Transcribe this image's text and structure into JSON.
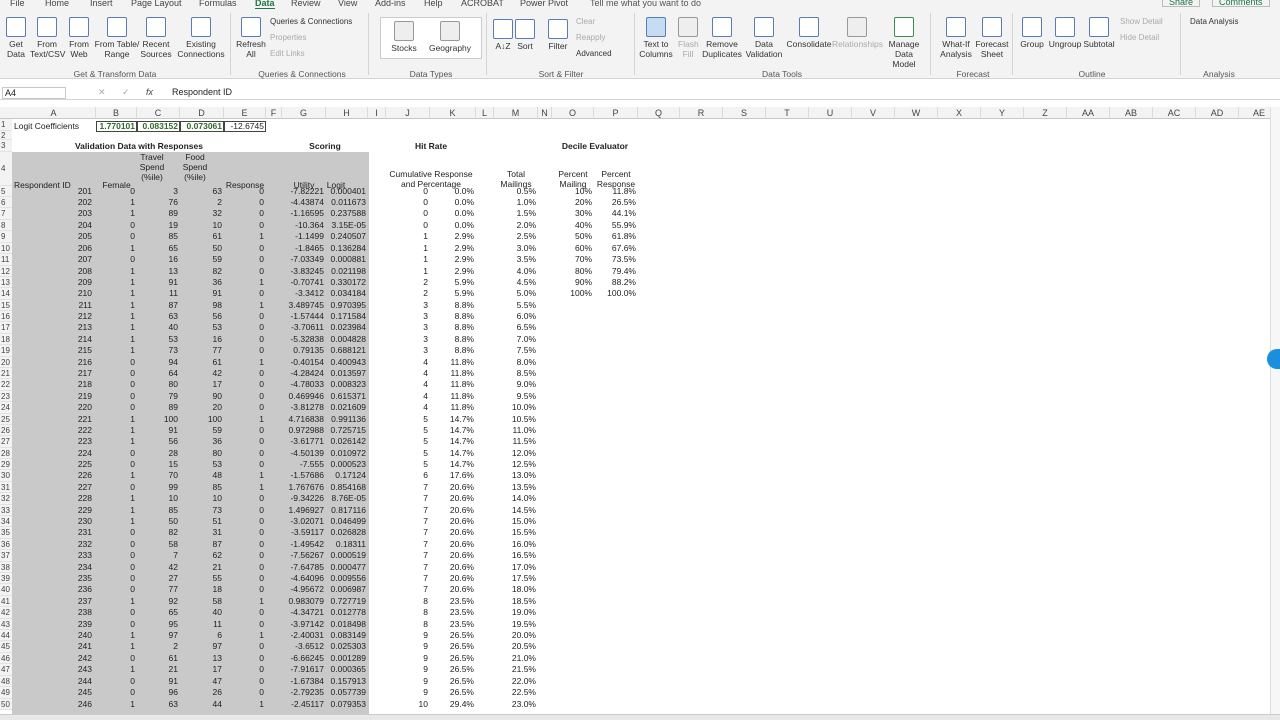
{
  "tabs": [
    "File",
    "Home",
    "Insert",
    "Page Layout",
    "Formulas",
    "Data",
    "Review",
    "View",
    "Add-ins",
    "Help",
    "ACROBAT",
    "Power Pivot"
  ],
  "active_tab": "Data",
  "tell_me": "Tell me what you want to do",
  "share": "Share",
  "comments": "Comments",
  "ribbon": {
    "get_data": "Get Data",
    "from_text": "From Text/CSV",
    "from_web": "From Web",
    "from_table": "From Table/ Range",
    "recent_sources": "Recent Sources",
    "existing_connections": "Existing Connections",
    "refresh_all": "Refresh All",
    "queries_connections": "Queries & Connections",
    "properties": "Properties",
    "edit_links": "Edit Links",
    "stocks": "Stocks",
    "geography": "Geography",
    "sort_az": "A↓Z",
    "sort": "Sort",
    "filter": "Filter",
    "clear": "Clear",
    "reapply": "Reapply",
    "advanced": "Advanced",
    "text_to_columns": "Text to Columns",
    "flash_fill": "Flash Fill",
    "remove_duplicates": "Remove Duplicates",
    "data_validation": "Data Validation",
    "consolidate": "Consolidate",
    "relationships": "Relationships",
    "manage_data_model": "Manage Data Model",
    "what_if": "What-If Analysis",
    "forecast_sheet": "Forecast Sheet",
    "group": "Group",
    "ungroup": "Ungroup",
    "subtotal": "Subtotal",
    "show_detail": "Show Detail",
    "hide_detail": "Hide Detail",
    "data_analysis": "Data Analysis",
    "groups": [
      "Get & Transform Data",
      "Queries & Connections",
      "Data Types",
      "Sort & Filter",
      "Data Tools",
      "Forecast",
      "Outline",
      "Analysis"
    ]
  },
  "formula_bar": {
    "name_box": "A4",
    "cancel": "✕",
    "enter": "✓",
    "fx": "fx",
    "content": "Respondent ID"
  },
  "columns": [
    "A",
    "B",
    "C",
    "D",
    "E",
    "F",
    "G",
    "H",
    "I",
    "J",
    "K",
    "L",
    "M",
    "N",
    "O",
    "P",
    "Q",
    "R",
    "S",
    "T",
    "U",
    "V",
    "W",
    "X",
    "Y",
    "Z",
    "AA",
    "AB",
    "AC",
    "AD",
    "AE"
  ],
  "row1": {
    "label": "Logit Coefficients",
    "c1": "1.770101",
    "c2": "0.083152",
    "c3": "0.073061",
    "c4": "-12.6745"
  },
  "headers": {
    "validation": "Validation Data with Responses",
    "scoring": "Scoring",
    "hit_rate": "Hit Rate",
    "decile": "Decile Evaluator",
    "respondent_id": "Respondent ID",
    "female": "Female",
    "travel_spend": "Travel Spend (%ile)",
    "food_spend": "Food Spend (%ile)",
    "response": "Response",
    "utility": "Utility",
    "logit": "Logit",
    "cumulative": "Cumulative Response and Percentage",
    "total_mailings": "Total Mailings",
    "percent_mailing": "Percent Mailing",
    "percent_response": "Percent Response"
  },
  "rows": [
    [
      "201",
      "0",
      "3",
      "63",
      "0",
      "-7.82221",
      "0.000401",
      "0",
      "0.0%",
      "0.5%"
    ],
    [
      "202",
      "1",
      "76",
      "2",
      "0",
      "-4.43874",
      "0.011673",
      "0",
      "0.0%",
      "1.0%"
    ],
    [
      "203",
      "1",
      "89",
      "32",
      "0",
      "-1.16595",
      "0.237588",
      "0",
      "0.0%",
      "1.5%"
    ],
    [
      "204",
      "0",
      "19",
      "10",
      "0",
      "-10.364",
      "3.15E-05",
      "0",
      "0.0%",
      "2.0%"
    ],
    [
      "205",
      "0",
      "85",
      "61",
      "1",
      "-1.1499",
      "0.240507",
      "1",
      "2.9%",
      "2.5%"
    ],
    [
      "206",
      "1",
      "65",
      "50",
      "0",
      "-1.8465",
      "0.136284",
      "1",
      "2.9%",
      "3.0%"
    ],
    [
      "207",
      "0",
      "16",
      "59",
      "0",
      "-7.03349",
      "0.000881",
      "1",
      "2.9%",
      "3.5%"
    ],
    [
      "208",
      "1",
      "13",
      "82",
      "0",
      "-3.83245",
      "0.021198",
      "1",
      "2.9%",
      "4.0%"
    ],
    [
      "209",
      "1",
      "91",
      "36",
      "1",
      "-0.70741",
      "0.330172",
      "2",
      "5.9%",
      "4.5%"
    ],
    [
      "210",
      "1",
      "11",
      "91",
      "0",
      "-3.3412",
      "0.034184",
      "2",
      "5.9%",
      "5.0%"
    ],
    [
      "211",
      "1",
      "87",
      "98",
      "1",
      "3.489745",
      "0.970395",
      "3",
      "8.8%",
      "5.5%"
    ],
    [
      "212",
      "1",
      "63",
      "56",
      "0",
      "-1.57444",
      "0.171584",
      "3",
      "8.8%",
      "6.0%"
    ],
    [
      "213",
      "1",
      "40",
      "53",
      "0",
      "-3.70611",
      "0.023984",
      "3",
      "8.8%",
      "6.5%"
    ],
    [
      "214",
      "1",
      "53",
      "16",
      "0",
      "-5.32838",
      "0.004828",
      "3",
      "8.8%",
      "7.0%"
    ],
    [
      "215",
      "1",
      "73",
      "77",
      "0",
      "0.79135",
      "0.688121",
      "3",
      "8.8%",
      "7.5%"
    ],
    [
      "216",
      "0",
      "94",
      "61",
      "1",
      "-0.40154",
      "0.400943",
      "4",
      "11.8%",
      "8.0%"
    ],
    [
      "217",
      "0",
      "64",
      "42",
      "0",
      "-4.28424",
      "0.013597",
      "4",
      "11.8%",
      "8.5%"
    ],
    [
      "218",
      "0",
      "80",
      "17",
      "0",
      "-4.78033",
      "0.008323",
      "4",
      "11.8%",
      "9.0%"
    ],
    [
      "219",
      "0",
      "79",
      "90",
      "0",
      "0.469946",
      "0.615371",
      "4",
      "11.8%",
      "9.5%"
    ],
    [
      "220",
      "0",
      "89",
      "20",
      "0",
      "-3.81278",
      "0.021609",
      "4",
      "11.8%",
      "10.0%"
    ],
    [
      "221",
      "1",
      "100",
      "100",
      "1",
      "4.716838",
      "0.991136",
      "5",
      "14.7%",
      "10.5%"
    ],
    [
      "222",
      "1",
      "91",
      "59",
      "0",
      "0.972988",
      "0.725715",
      "5",
      "14.7%",
      "11.0%"
    ],
    [
      "223",
      "1",
      "56",
      "36",
      "0",
      "-3.61771",
      "0.026142",
      "5",
      "14.7%",
      "11.5%"
    ],
    [
      "224",
      "0",
      "28",
      "80",
      "0",
      "-4.50139",
      "0.010972",
      "5",
      "14.7%",
      "12.0%"
    ],
    [
      "225",
      "0",
      "15",
      "53",
      "0",
      "-7.555",
      "0.000523",
      "5",
      "14.7%",
      "12.5%"
    ],
    [
      "226",
      "1",
      "70",
      "48",
      "1",
      "-1.57686",
      "0.17124",
      "6",
      "17.6%",
      "13.0%"
    ],
    [
      "227",
      "0",
      "99",
      "85",
      "1",
      "1.767676",
      "0.854168",
      "7",
      "20.6%",
      "13.5%"
    ],
    [
      "228",
      "1",
      "10",
      "10",
      "0",
      "-9.34226",
      "8.76E-05",
      "7",
      "20.6%",
      "14.0%"
    ],
    [
      "229",
      "1",
      "85",
      "73",
      "0",
      "1.496927",
      "0.817116",
      "7",
      "20.6%",
      "14.5%"
    ],
    [
      "230",
      "1",
      "50",
      "51",
      "0",
      "-3.02071",
      "0.046499",
      "7",
      "20.6%",
      "15.0%"
    ],
    [
      "231",
      "0",
      "82",
      "31",
      "0",
      "-3.59117",
      "0.026828",
      "7",
      "20.6%",
      "15.5%"
    ],
    [
      "232",
      "0",
      "58",
      "87",
      "0",
      "-1.49542",
      "0.18311",
      "7",
      "20.6%",
      "16.0%"
    ],
    [
      "233",
      "0",
      "7",
      "62",
      "0",
      "-7.56267",
      "0.000519",
      "7",
      "20.6%",
      "16.5%"
    ],
    [
      "234",
      "0",
      "42",
      "21",
      "0",
      "-7.64785",
      "0.000477",
      "7",
      "20.6%",
      "17.0%"
    ],
    [
      "235",
      "0",
      "27",
      "55",
      "0",
      "-4.64096",
      "0.009556",
      "7",
      "20.6%",
      "17.5%"
    ],
    [
      "236",
      "0",
      "77",
      "18",
      "0",
      "-4.95672",
      "0.006987",
      "7",
      "20.6%",
      "18.0%"
    ],
    [
      "237",
      "1",
      "92",
      "58",
      "1",
      "0.983079",
      "0.727719",
      "8",
      "23.5%",
      "18.5%"
    ],
    [
      "238",
      "0",
      "65",
      "40",
      "0",
      "-4.34721",
      "0.012778",
      "8",
      "23.5%",
      "19.0%"
    ],
    [
      "239",
      "0",
      "95",
      "11",
      "0",
      "-3.97142",
      "0.018498",
      "8",
      "23.5%",
      "19.5%"
    ],
    [
      "240",
      "1",
      "97",
      "6",
      "1",
      "-2.40031",
      "0.083149",
      "9",
      "26.5%",
      "20.0%"
    ],
    [
      "241",
      "1",
      "2",
      "97",
      "0",
      "-3.6512",
      "0.025303",
      "9",
      "26.5%",
      "20.5%"
    ],
    [
      "242",
      "0",
      "61",
      "13",
      "0",
      "-6.66245",
      "0.001289",
      "9",
      "26.5%",
      "21.0%"
    ],
    [
      "243",
      "1",
      "21",
      "17",
      "0",
      "-7.91617",
      "0.000365",
      "9",
      "26.5%",
      "21.5%"
    ],
    [
      "244",
      "0",
      "91",
      "47",
      "0",
      "-1.67384",
      "0.157913",
      "9",
      "26.5%",
      "22.0%"
    ],
    [
      "245",
      "0",
      "96",
      "26",
      "0",
      "-2.79235",
      "0.057739",
      "9",
      "26.5%",
      "22.5%"
    ],
    [
      "246",
      "1",
      "63",
      "44",
      "1",
      "-2.45117",
      "0.079353",
      "10",
      "29.4%",
      "23.0%"
    ]
  ],
  "decile": [
    [
      "10%",
      "11.8%"
    ],
    [
      "20%",
      "26.5%"
    ],
    [
      "30%",
      "44.1%"
    ],
    [
      "40%",
      "55.9%"
    ],
    [
      "50%",
      "61.8%"
    ],
    [
      "60%",
      "67.6%"
    ],
    [
      "70%",
      "73.5%"
    ],
    [
      "80%",
      "79.4%"
    ],
    [
      "90%",
      "88.2%"
    ],
    [
      "100%",
      "100.0%"
    ]
  ]
}
